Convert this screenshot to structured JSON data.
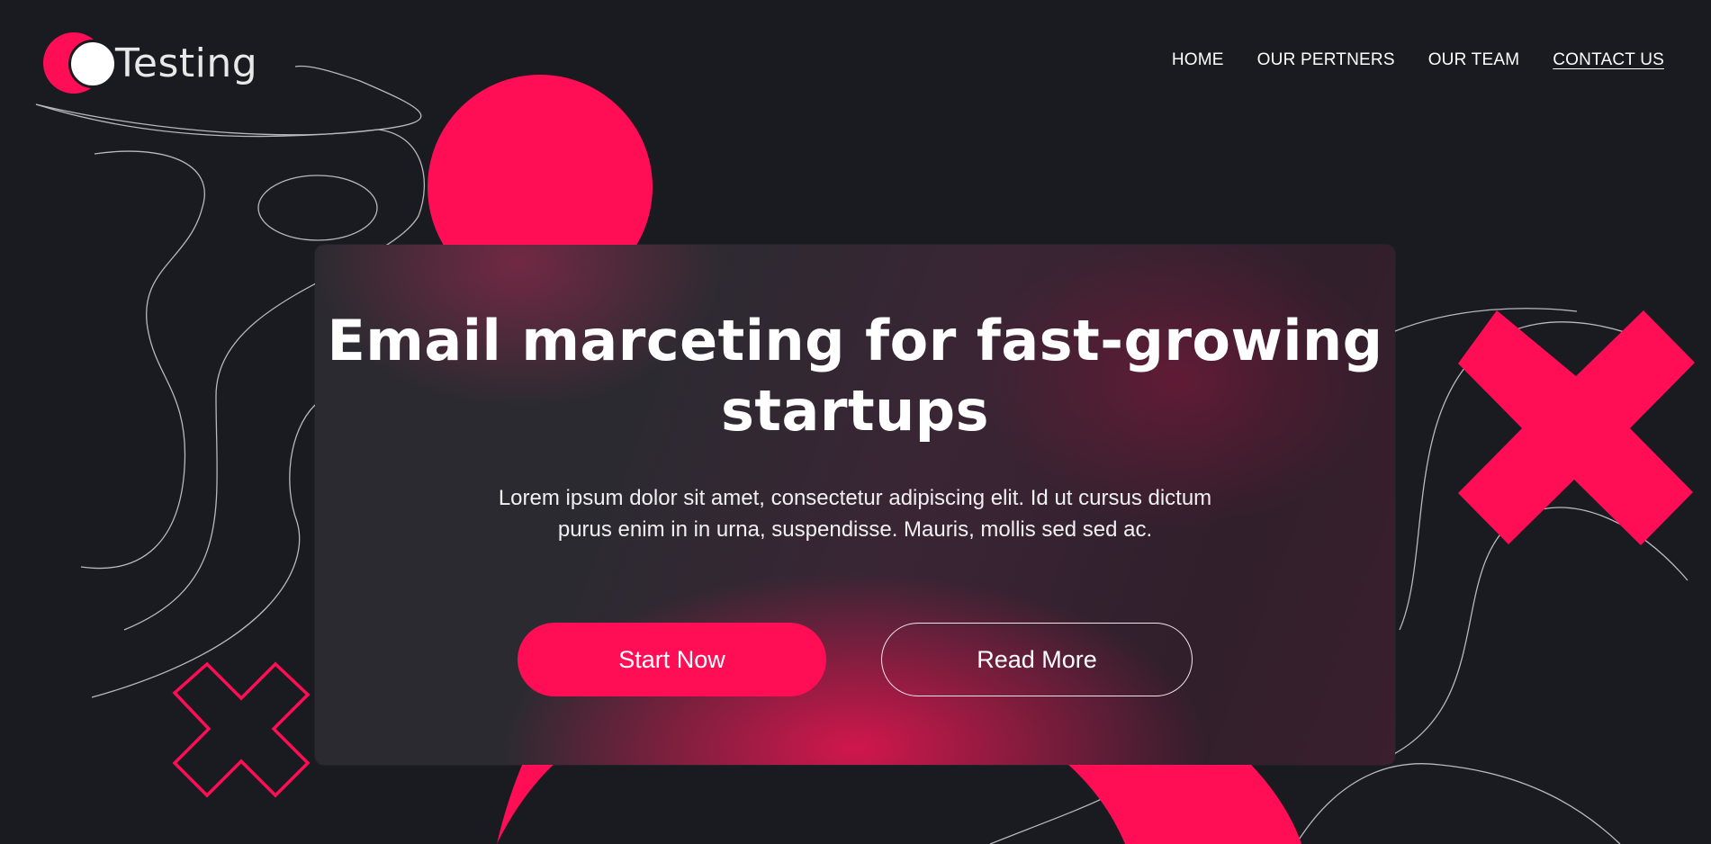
{
  "brand": {
    "name": "Testing"
  },
  "nav": {
    "items": [
      {
        "label": "HOME"
      },
      {
        "label": "OUR PERTNERS"
      },
      {
        "label": "OUR TEAM"
      },
      {
        "label": "CONTACT US"
      }
    ]
  },
  "hero": {
    "title": "Email marceting for fast-growing startups",
    "subtitle": "Lorem ipsum dolor sit amet, consectetur adipiscing elit. Id ut cursus dictum purus enim in in urna, suspendisse. Mauris, mollis sed sed ac.",
    "primary_button": "Start Now",
    "secondary_button": "Read More"
  },
  "colors": {
    "background": "#1a1b20",
    "accent": "#ff0d55",
    "text": "#ffffff"
  },
  "icons": {
    "logo": "circle-logo-icon",
    "decor": [
      "pink-circle-shape",
      "pink-x-shape",
      "outline-x-shape",
      "contour-lines"
    ]
  }
}
